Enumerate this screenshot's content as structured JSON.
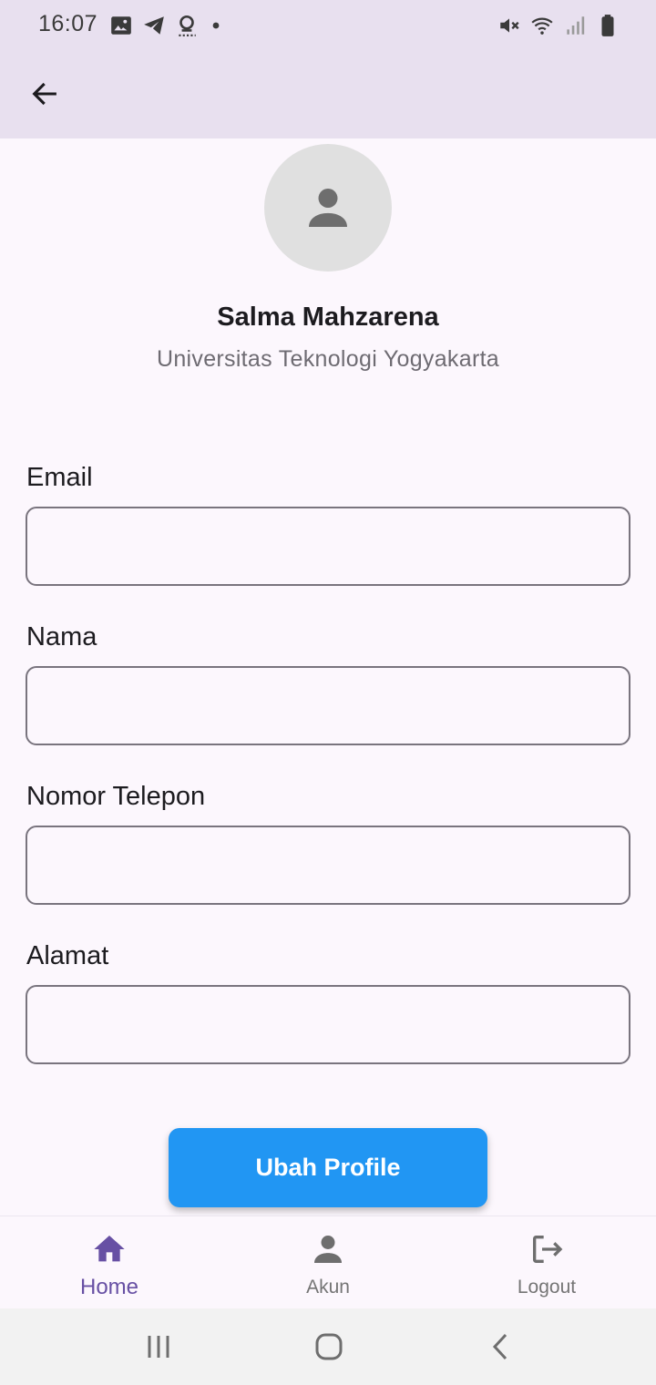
{
  "status_bar": {
    "time": "16:07",
    "left_icons": [
      "gallery-icon",
      "telegram-icon",
      "cast-icon",
      "dot-icon"
    ],
    "right_icons": [
      "mute-icon",
      "wifi-icon",
      "signal-icon",
      "battery-icon"
    ]
  },
  "app_bar": {
    "back_icon": "arrow-left-icon"
  },
  "profile": {
    "avatar_icon": "person-icon",
    "name": "Salma Mahzarena",
    "organization": "Universitas Teknologi Yogyakarta"
  },
  "form": {
    "email": {
      "label": "Email",
      "value": ""
    },
    "nama": {
      "label": "Nama",
      "value": ""
    },
    "telepon": {
      "label": "Nomor Telepon",
      "value": ""
    },
    "alamat": {
      "label": "Alamat",
      "value": ""
    },
    "submit_label": "Ubah Profile"
  },
  "bottom_nav": {
    "items": [
      {
        "label": "Home",
        "icon": "home-icon",
        "active": true
      },
      {
        "label": "Akun",
        "icon": "person-icon",
        "active": false
      },
      {
        "label": "Logout",
        "icon": "logout-icon",
        "active": false
      }
    ]
  },
  "system_nav": {
    "icons": [
      "recent-apps-icon",
      "home-circle-icon",
      "back-chevron-icon"
    ]
  },
  "colors": {
    "app_bar": "#e8e0ef",
    "background": "#fcf7fd",
    "primary_button": "#2196f3",
    "nav_active": "#6750a4",
    "nav_inactive": "#757575"
  }
}
